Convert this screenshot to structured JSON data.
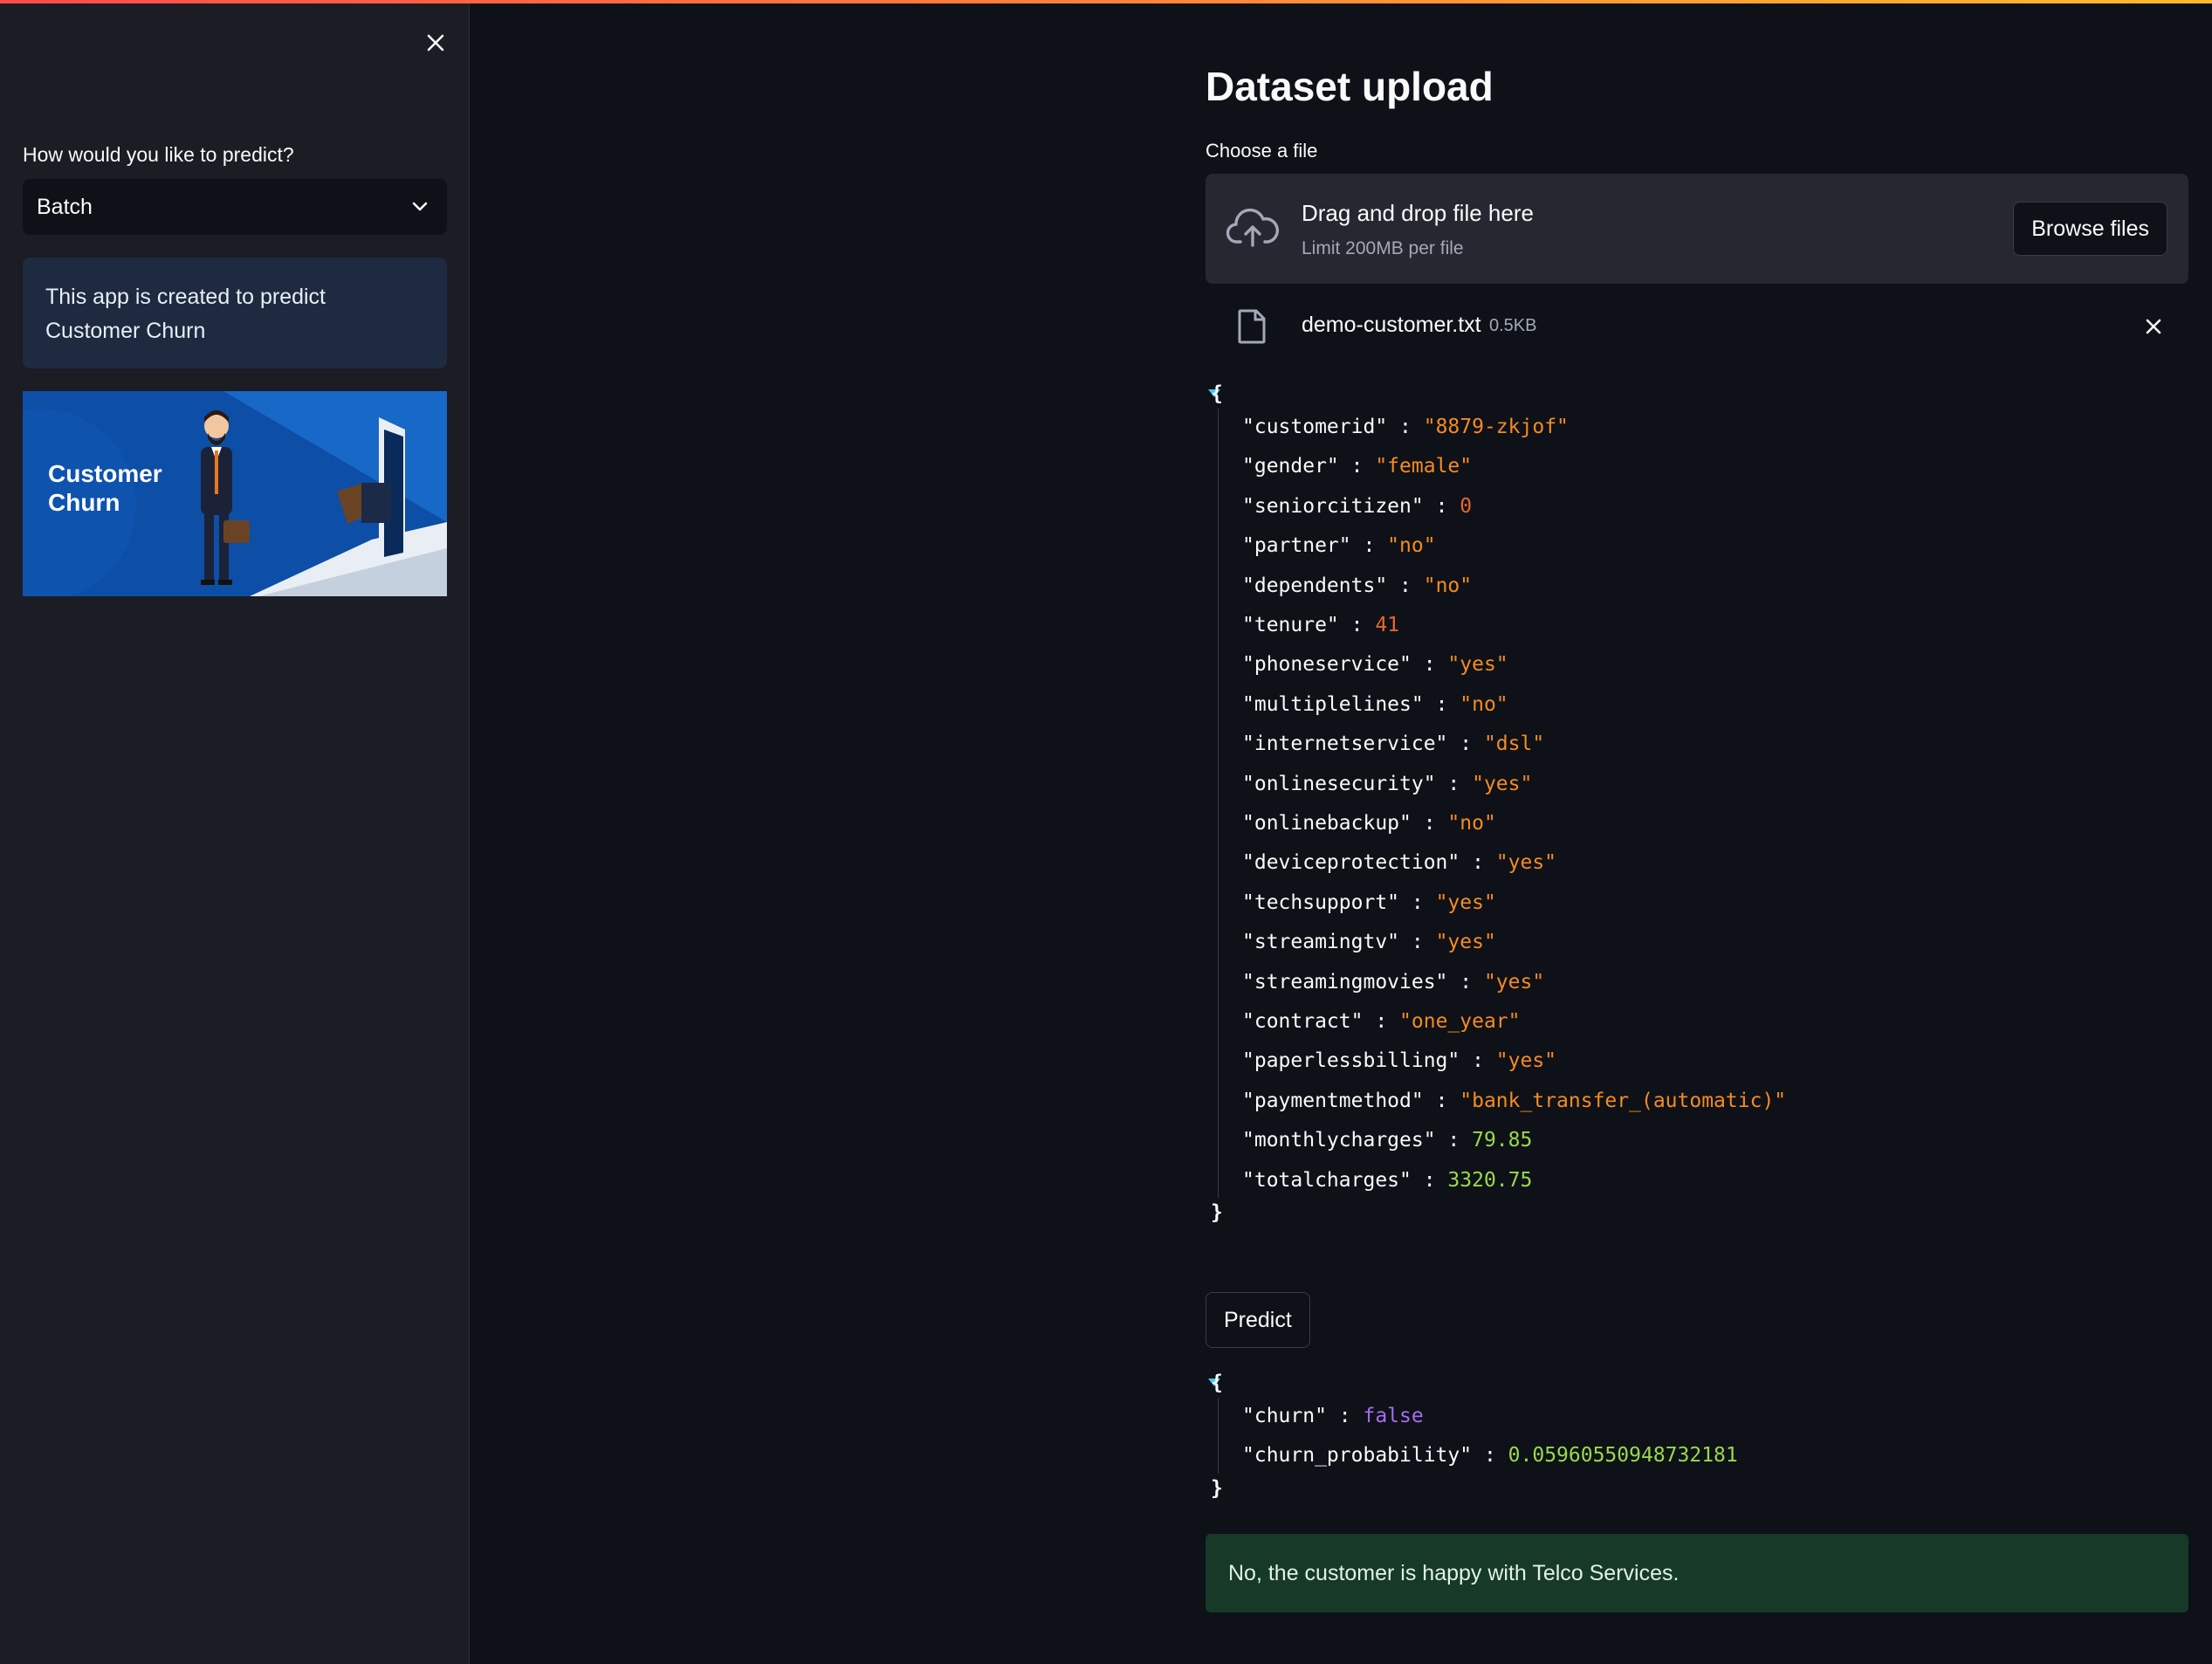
{
  "colors": {
    "accent_gradient_start": "#ff4b4b",
    "accent_gradient_end": "#fdba2c",
    "background": "#0e1117",
    "sidebar": "#1b1c24",
    "json_string": "#f58b22",
    "json_int": "#e7662e",
    "json_float": "#9ad94a",
    "json_bool": "#a66cf2",
    "success_bg": "#173928"
  },
  "sidebar": {
    "close_icon": "close-icon",
    "select_label": "How would you like to predict?",
    "select_value": "Batch",
    "info_text": "This app is created to predict Customer Churn",
    "banner_title": "Customer Churn"
  },
  "main": {
    "title": "Dataset upload",
    "uploader": {
      "label": "Choose a file",
      "drop_text": "Drag and drop file here",
      "limit_text": "Limit 200MB per file",
      "browse_label": "Browse files"
    },
    "file": {
      "name": "demo-customer.txt",
      "size": "0.5KB"
    },
    "input_json": [
      {
        "key": "\"customerid\"",
        "value": "\"8879-zkjof\"",
        "type": "s"
      },
      {
        "key": "\"gender\"",
        "value": "\"female\"",
        "type": "s"
      },
      {
        "key": "\"seniorcitizen\"",
        "value": "0",
        "type": "n"
      },
      {
        "key": "\"partner\"",
        "value": "\"no\"",
        "type": "s"
      },
      {
        "key": "\"dependents\"",
        "value": "\"no\"",
        "type": "s"
      },
      {
        "key": "\"tenure\"",
        "value": "41",
        "type": "n"
      },
      {
        "key": "\"phoneservice\"",
        "value": "\"yes\"",
        "type": "s"
      },
      {
        "key": "\"multiplelines\"",
        "value": "\"no\"",
        "type": "s"
      },
      {
        "key": "\"internetservice\"",
        "value": "\"dsl\"",
        "type": "s"
      },
      {
        "key": "\"onlinesecurity\"",
        "value": "\"yes\"",
        "type": "s"
      },
      {
        "key": "\"onlinebackup\"",
        "value": "\"no\"",
        "type": "s"
      },
      {
        "key": "\"deviceprotection\"",
        "value": "\"yes\"",
        "type": "s"
      },
      {
        "key": "\"techsupport\"",
        "value": "\"yes\"",
        "type": "s"
      },
      {
        "key": "\"streamingtv\"",
        "value": "\"yes\"",
        "type": "s"
      },
      {
        "key": "\"streamingmovies\"",
        "value": "\"yes\"",
        "type": "s"
      },
      {
        "key": "\"contract\"",
        "value": "\"one_year\"",
        "type": "s"
      },
      {
        "key": "\"paperlessbilling\"",
        "value": "\"yes\"",
        "type": "s"
      },
      {
        "key": "\"paymentmethod\"",
        "value": "\"bank_transfer_(automatic)\"",
        "type": "s"
      },
      {
        "key": "\"monthlycharges\"",
        "value": "79.85",
        "type": "f"
      },
      {
        "key": "\"totalcharges\"",
        "value": "3320.75",
        "type": "f"
      }
    ],
    "predict_label": "Predict",
    "result_json": [
      {
        "key": "\"churn\"",
        "value": "false",
        "type": "b"
      },
      {
        "key": "\"churn_probability\"",
        "value": "0.05960550948732181",
        "type": "f"
      }
    ],
    "success_text": "No, the customer is happy with Telco Services."
  }
}
